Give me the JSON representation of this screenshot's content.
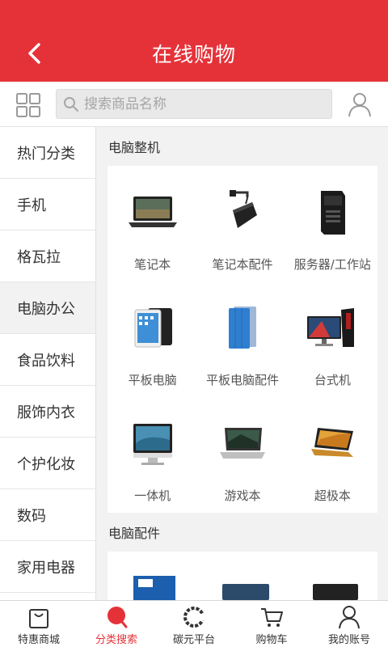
{
  "header": {
    "title": "在线购物",
    "back_icon": "chevron-left-icon"
  },
  "search": {
    "placeholder": "搜索商品名称"
  },
  "sidebar": {
    "items": [
      {
        "label": "热门分类"
      },
      {
        "label": "手机"
      },
      {
        "label": "格瓦拉"
      },
      {
        "label": "电脑办公",
        "active": true
      },
      {
        "label": "食品饮料"
      },
      {
        "label": "服饰内衣"
      },
      {
        "label": "个护化妆"
      },
      {
        "label": "数码"
      },
      {
        "label": "家用电器"
      }
    ]
  },
  "content": {
    "sections": [
      {
        "title": "电脑整机",
        "products": [
          {
            "label": "笔记本",
            "icon": "laptop-icon"
          },
          {
            "label": "笔记本配件",
            "icon": "power-adapter-icon"
          },
          {
            "label": "服务器/工作站",
            "icon": "server-tower-icon"
          },
          {
            "label": "平板电脑",
            "icon": "tablet-icon"
          },
          {
            "label": "平板电脑配件",
            "icon": "tablet-case-icon"
          },
          {
            "label": "台式机",
            "icon": "desktop-pc-icon"
          },
          {
            "label": "一体机",
            "icon": "all-in-one-icon"
          },
          {
            "label": "游戏本",
            "icon": "gaming-laptop-icon"
          },
          {
            "label": "超极本",
            "icon": "ultrabook-icon"
          }
        ]
      },
      {
        "title": "电脑配件"
      }
    ]
  },
  "bottom_nav": {
    "items": [
      {
        "label": "特惠商城",
        "icon": "shopping-bag-icon"
      },
      {
        "label": "分类搜索",
        "icon": "search-category-icon",
        "active": true
      },
      {
        "label": "碳元平台",
        "icon": "carbon-logo-icon"
      },
      {
        "label": "购物车",
        "icon": "cart-icon"
      },
      {
        "label": "我的账号",
        "icon": "account-icon"
      }
    ]
  },
  "colors": {
    "brand_red": "#e53239",
    "background": "#f2f2f2"
  }
}
